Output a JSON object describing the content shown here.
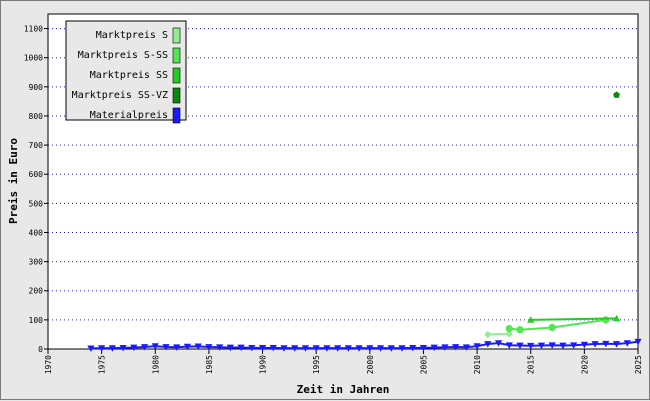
{
  "chart_data": {
    "type": "line",
    "xlabel": "Zeit in Jahren",
    "ylabel": "Preis in Euro",
    "xlim": [
      1970,
      2025
    ],
    "ylim": [
      0,
      1150
    ],
    "x_ticks": [
      "1970",
      "1975",
      "1980",
      "1985",
      "1990",
      "1995",
      "2000",
      "2005",
      "2010",
      "2015",
      "2020",
      "2025"
    ],
    "y_ticks": [
      "0",
      "100",
      "200",
      "300",
      "400",
      "500",
      "600",
      "700",
      "800",
      "900",
      "1000",
      "1100"
    ],
    "grid": "horizontal dotted",
    "legend_position": "top-left",
    "series": [
      {
        "name": "Marktpreis S",
        "color": "#90ee90",
        "marker": "diamond",
        "points": [
          [
            2011,
            50
          ],
          [
            2013,
            52
          ]
        ]
      },
      {
        "name": "Marktpreis S-SS",
        "color": "#50e850",
        "marker": "circle",
        "points": [
          [
            2013,
            70
          ],
          [
            2014,
            66
          ],
          [
            2017,
            74
          ],
          [
            2022,
            100
          ]
        ]
      },
      {
        "name": "Marktpreis SS",
        "color": "#22cc22",
        "marker": "triangle-up",
        "points": [
          [
            2015,
            100
          ],
          [
            2023,
            105
          ]
        ]
      },
      {
        "name": "Marktpreis SS-VZ",
        "color": "#0a8c0a",
        "marker": "pentagon",
        "points": [
          [
            2023,
            872
          ]
        ]
      },
      {
        "name": "Materialpreis",
        "color": "#1a1aff",
        "marker": "triangle-down",
        "points": [
          [
            1974,
            2
          ],
          [
            1975,
            3
          ],
          [
            1976,
            3
          ],
          [
            1977,
            4
          ],
          [
            1978,
            5
          ],
          [
            1979,
            7
          ],
          [
            1980,
            10
          ],
          [
            1981,
            7
          ],
          [
            1982,
            6
          ],
          [
            1983,
            8
          ],
          [
            1984,
            9
          ],
          [
            1985,
            7
          ],
          [
            1986,
            6
          ],
          [
            1987,
            5
          ],
          [
            1988,
            5
          ],
          [
            1989,
            4
          ],
          [
            1990,
            4
          ],
          [
            1991,
            4
          ],
          [
            1992,
            3
          ],
          [
            1993,
            3
          ],
          [
            1994,
            3
          ],
          [
            1995,
            3
          ],
          [
            1996,
            3
          ],
          [
            1997,
            3
          ],
          [
            1998,
            3
          ],
          [
            1999,
            3
          ],
          [
            2000,
            3
          ],
          [
            2001,
            3
          ],
          [
            2002,
            3
          ],
          [
            2003,
            3
          ],
          [
            2004,
            4
          ],
          [
            2005,
            4
          ],
          [
            2006,
            5
          ],
          [
            2007,
            6
          ],
          [
            2008,
            7
          ],
          [
            2009,
            6
          ],
          [
            2010,
            10
          ],
          [
            2011,
            17
          ],
          [
            2012,
            20
          ],
          [
            2013,
            13
          ],
          [
            2014,
            12
          ],
          [
            2015,
            11
          ],
          [
            2016,
            12
          ],
          [
            2017,
            13
          ],
          [
            2018,
            12
          ],
          [
            2019,
            13
          ],
          [
            2020,
            15
          ],
          [
            2021,
            17
          ],
          [
            2022,
            18
          ],
          [
            2023,
            17
          ],
          [
            2024,
            20
          ],
          [
            2025,
            25
          ]
        ]
      }
    ]
  }
}
